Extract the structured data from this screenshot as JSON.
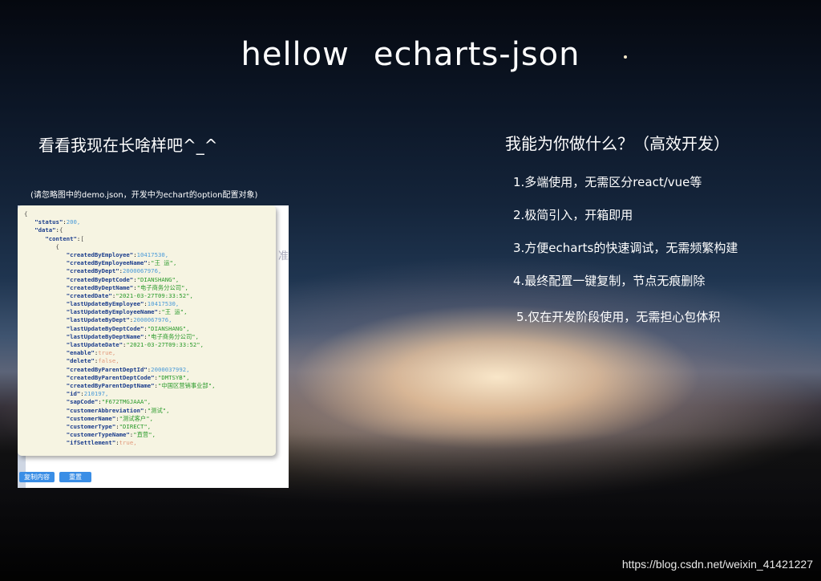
{
  "title": {
    "part1": "hellow",
    "part2": "echarts-json"
  },
  "left_heading": "看看我现在长啥样吧^_^",
  "note": "(请忽略图中的demo.json，开发中为echart的option配置对象)",
  "right_heading": "我能为你做什么？（高效开发）",
  "features": [
    "1.多端使用，无需区分react/vue等",
    "2.极简引入，开箱即用",
    "3.方便echarts的快速调试，无需频繁构建",
    "4.最终配置一键复制，节点无痕删除",
    "5.仅在开发阶段使用，无需担心包体积"
  ],
  "json_preview": [
    {
      "indent": 0,
      "key": "",
      "val": "{",
      "type": "p"
    },
    {
      "indent": 1,
      "key": "status",
      "val": "200,",
      "type": "n"
    },
    {
      "indent": 1,
      "key": "data",
      "val": "{",
      "type": "p"
    },
    {
      "indent": 2,
      "key": "content",
      "val": "[",
      "type": "p"
    },
    {
      "indent": 3,
      "key": "",
      "val": "{",
      "type": "p"
    },
    {
      "indent": 4,
      "key": "createdByEmployee",
      "val": "10417530,",
      "type": "n"
    },
    {
      "indent": 4,
      "key": "createdByEmployeeName",
      "val": "\"王 运\",",
      "type": "s"
    },
    {
      "indent": 4,
      "key": "createdByDept",
      "val": "2000067976,",
      "type": "n"
    },
    {
      "indent": 4,
      "key": "createdByDeptCode",
      "val": "\"DIANSHANG\",",
      "type": "s"
    },
    {
      "indent": 4,
      "key": "createdByDeptName",
      "val": "\"电子商务分公司\",",
      "type": "s"
    },
    {
      "indent": 4,
      "key": "createdDate",
      "val": "\"2021-03-27T09:33:52\",",
      "type": "s"
    },
    {
      "indent": 4,
      "key": "lastUpdateByEmployee",
      "val": "10417530,",
      "type": "n"
    },
    {
      "indent": 4,
      "key": "lastUpdateByEmployeeName",
      "val": "\"王 运\",",
      "type": "s"
    },
    {
      "indent": 4,
      "key": "lastUpdateByDept",
      "val": "2000067976,",
      "type": "n"
    },
    {
      "indent": 4,
      "key": "lastUpdateByDeptCode",
      "val": "\"DIANSHANG\",",
      "type": "s"
    },
    {
      "indent": 4,
      "key": "lastUpdateByDeptName",
      "val": "\"电子商务分公司\",",
      "type": "s"
    },
    {
      "indent": 4,
      "key": "lastUpdateDate",
      "val": "\"2021-03-27T09:33:52\",",
      "type": "s"
    },
    {
      "indent": 4,
      "key": "enable",
      "val": "true,",
      "type": "b"
    },
    {
      "indent": 4,
      "key": "delete",
      "val": "false,",
      "type": "b"
    },
    {
      "indent": 4,
      "key": "createdByParentDeptId",
      "val": "2000037992,",
      "type": "n"
    },
    {
      "indent": 4,
      "key": "createdByParentDeptCode",
      "val": "\"DMTSYB\",",
      "type": "s"
    },
    {
      "indent": 4,
      "key": "createdByParentDeptName",
      "val": "\"中国区营销事业部\",",
      "type": "s"
    },
    {
      "indent": 4,
      "key": "id",
      "val": "210197,",
      "type": "n"
    },
    {
      "indent": 4,
      "key": "sapCode",
      "val": "\"F672TMGJAAA\",",
      "type": "s"
    },
    {
      "indent": 4,
      "key": "customerAbbreviation",
      "val": "\"测试\",",
      "type": "s"
    },
    {
      "indent": 4,
      "key": "customerName",
      "val": "\"测试客户\",",
      "type": "s"
    },
    {
      "indent": 4,
      "key": "customerType",
      "val": "\"DIRECT\",",
      "type": "s"
    },
    {
      "indent": 4,
      "key": "customerTypeName",
      "val": "\"直营\",",
      "type": "s"
    },
    {
      "indent": 4,
      "key": "ifSettlement",
      "val": "true,",
      "type": "b"
    }
  ],
  "buttons": {
    "copy": "复制内容",
    "reset": "重置"
  },
  "bg_fragment": "准",
  "watermark": "https://blog.csdn.net/weixin_41421227"
}
